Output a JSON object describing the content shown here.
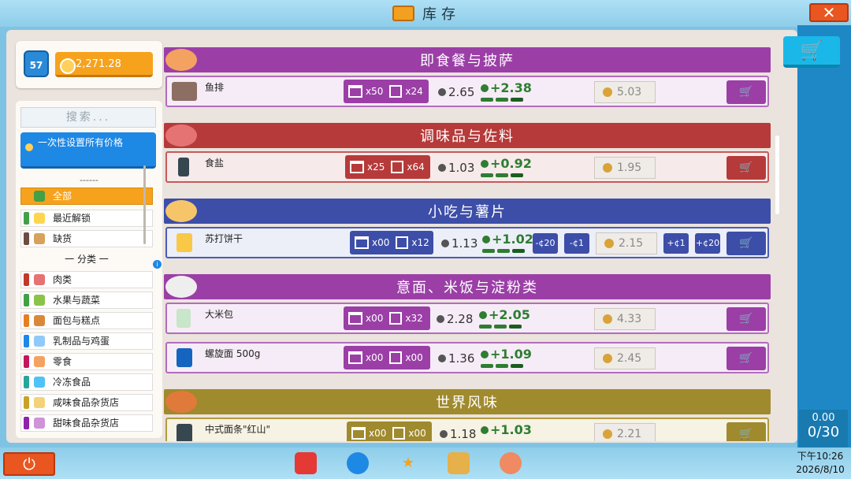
{
  "window": {
    "title": "库存",
    "close_label": "✕"
  },
  "player": {
    "level": "57",
    "money": "2,271.28"
  },
  "filters": {
    "search_placeholder": "搜索...",
    "set_all_label": "一次性设置所有价格",
    "divider": "------",
    "items": [
      {
        "label": "全部",
        "color": "#f6a21c",
        "icon": "basket-icon"
      },
      {
        "label": "最近解锁",
        "color": "#43a047",
        "icon": "sparkle-icon"
      },
      {
        "label": "缺货",
        "color": "#6d4c41",
        "icon": "sack-icon"
      }
    ],
    "info_badge": "i",
    "section_label": "一 分类 一",
    "categories": [
      {
        "label": "肉类",
        "color": "#c0392b",
        "icon": "meat-icon"
      },
      {
        "label": "水果与蔬菜",
        "color": "#43a047",
        "icon": "vegetables-icon"
      },
      {
        "label": "面包与糕点",
        "color": "#e67e22",
        "icon": "bread-icon"
      },
      {
        "label": "乳制品与鸡蛋",
        "color": "#1e88e5",
        "icon": "milk-icon"
      },
      {
        "label": "零食",
        "color": "#c2185b",
        "icon": "snack-icon"
      },
      {
        "label": "冷冻食品",
        "color": "#26a69a",
        "icon": "snowflake-icon"
      },
      {
        "label": "咸味食品杂货店",
        "color": "#c9a227",
        "icon": "salty-icon"
      },
      {
        "label": "甜味食品杂货店",
        "color": "#8e24aa",
        "icon": "sweet-icon"
      }
    ]
  },
  "product_list": {
    "sections": [
      {
        "title": "即食餐与披萨",
        "color": "#9b3fa7",
        "products": [
          {
            "name": "鱼排",
            "stock_shelf": "x50",
            "stock_box": "x24",
            "cost": "2.65",
            "market": "+2.38",
            "price": "5.03",
            "row_color": "#b06dbd",
            "row_bg": "#f6ecf7"
          }
        ]
      },
      {
        "title": "调味品与佐料",
        "color": "#b63a3a",
        "products": [
          {
            "name": "食盐",
            "stock_shelf": "x25",
            "stock_box": "x64",
            "cost": "1.03",
            "market": "+0.92",
            "price": "1.95",
            "row_color": "#c65a5a",
            "row_bg": "#f7eaea"
          }
        ]
      },
      {
        "title": "小吃与薯片",
        "color": "#3d4ea8",
        "products": [
          {
            "name": "苏打饼干",
            "stock_shelf": "x00",
            "stock_box": "x12",
            "cost": "1.13",
            "market": "+1.02",
            "price": "2.15",
            "row_color": "#4a5cb8",
            "row_bg": "#eceef8",
            "adjust_minus": [
              "-¢20",
              "-¢1"
            ],
            "adjust_plus": [
              "+¢1",
              "+¢20"
            ]
          }
        ]
      },
      {
        "title": "意面、米饭与淀粉类",
        "color": "#9b3fa7",
        "products": [
          {
            "name": "大米包",
            "stock_shelf": "x00",
            "stock_box": "x32",
            "cost": "2.28",
            "market": "+2.05",
            "price": "4.33",
            "row_color": "#b06dbd",
            "row_bg": "#f6ecf7"
          },
          {
            "name": "螺旋面 500g",
            "stock_shelf": "x00",
            "stock_box": "x00",
            "cost": "1.36",
            "market": "+1.09",
            "price": "2.45",
            "row_color": "#b06dbd",
            "row_bg": "#f6ecf7"
          }
        ]
      },
      {
        "title": "世界风味",
        "color": "#a08a2e",
        "products": [
          {
            "name": "中式面条\"红山\"",
            "stock_shelf": "x00",
            "stock_box": "x00",
            "cost": "1.18",
            "market": "+1.03",
            "price": "2.21",
            "row_color": "#b29c3e",
            "row_bg": "#f6f2e4"
          }
        ]
      }
    ]
  },
  "cart": {
    "count_money": "0.00",
    "capacity": "0/30"
  },
  "bottom": {
    "power_label": "⏻",
    "icons": [
      "shopping-bag-icon",
      "settings-icon",
      "star-icon",
      "boxes-icon",
      "staff-icon"
    ],
    "time": "下午10:26",
    "date": "2026/8/10"
  }
}
